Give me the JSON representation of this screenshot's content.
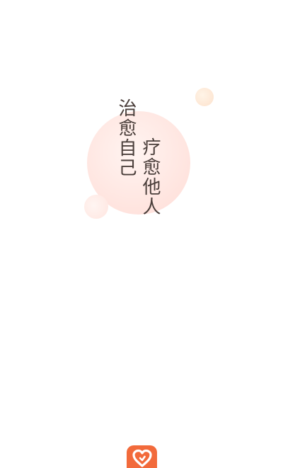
{
  "splash": {
    "slogan_left": "治愈自己",
    "slogan_right": "疗愈他人"
  },
  "logo": {
    "icon": "heart-icon",
    "color": "#f26a3b"
  }
}
